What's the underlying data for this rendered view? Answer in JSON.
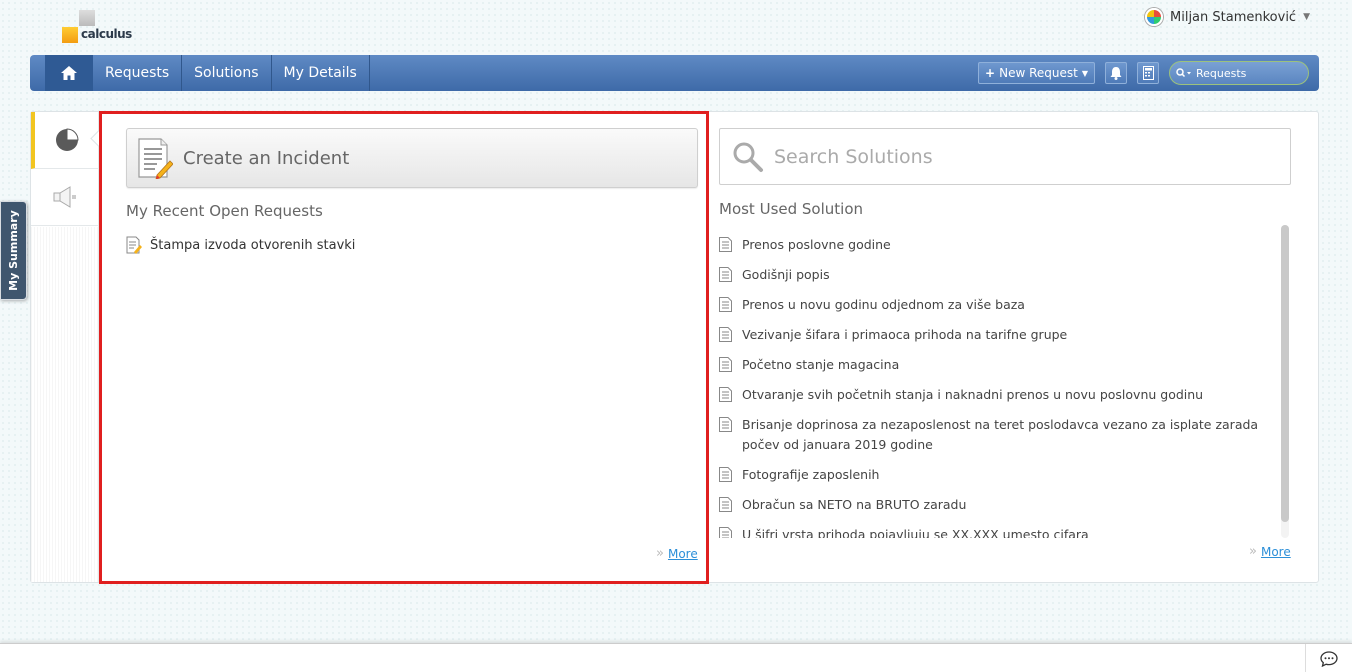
{
  "brand": {
    "logo_text": "calculus"
  },
  "user": {
    "name": "Miljan Stamenković"
  },
  "nav": {
    "items": [
      {
        "label": "Requests"
      },
      {
        "label": "Solutions"
      },
      {
        "label": "My Details"
      }
    ],
    "new_request_label": "New Request",
    "search_placeholder": "Requests"
  },
  "side": {
    "my_summary_label": "My Summary"
  },
  "left": {
    "create_label": "Create an Incident",
    "recent_title": "My Recent Open Requests",
    "recent_items": [
      {
        "label": "Štampa izvoda otvorenih stavki"
      }
    ],
    "more_label": "More"
  },
  "right": {
    "search_placeholder": "Search Solutions",
    "most_used_title": "Most Used Solution",
    "solutions": [
      {
        "label": "Prenos poslovne godine"
      },
      {
        "label": "Godišnji popis"
      },
      {
        "label": "Prenos u novu godinu odjednom za više baza"
      },
      {
        "label": "Vezivanje šifara i primaoca prihoda na tarifne grupe"
      },
      {
        "label": "Početno stanje magacina"
      },
      {
        "label": "Otvaranje svih početnih stanja i naknadni prenos u novu poslovnu godinu"
      },
      {
        "label": "Brisanje doprinosa za nezaposlenost na teret poslodavca vezano za isplate zarada počev od januara 2019 godine"
      },
      {
        "label": "Fotografije zaposlenih"
      },
      {
        "label": "Obračun sa NETO na BRUTO zaradu"
      },
      {
        "label": "U šifri vrsta prihoda pojavljuju se XX.XXX umesto cifara"
      }
    ],
    "more_label": "More"
  },
  "colors": {
    "nav": "#4f7bb8",
    "highlight": "#e01f1f",
    "active_tab": "#f2c521",
    "link": "#2c8fd8"
  }
}
